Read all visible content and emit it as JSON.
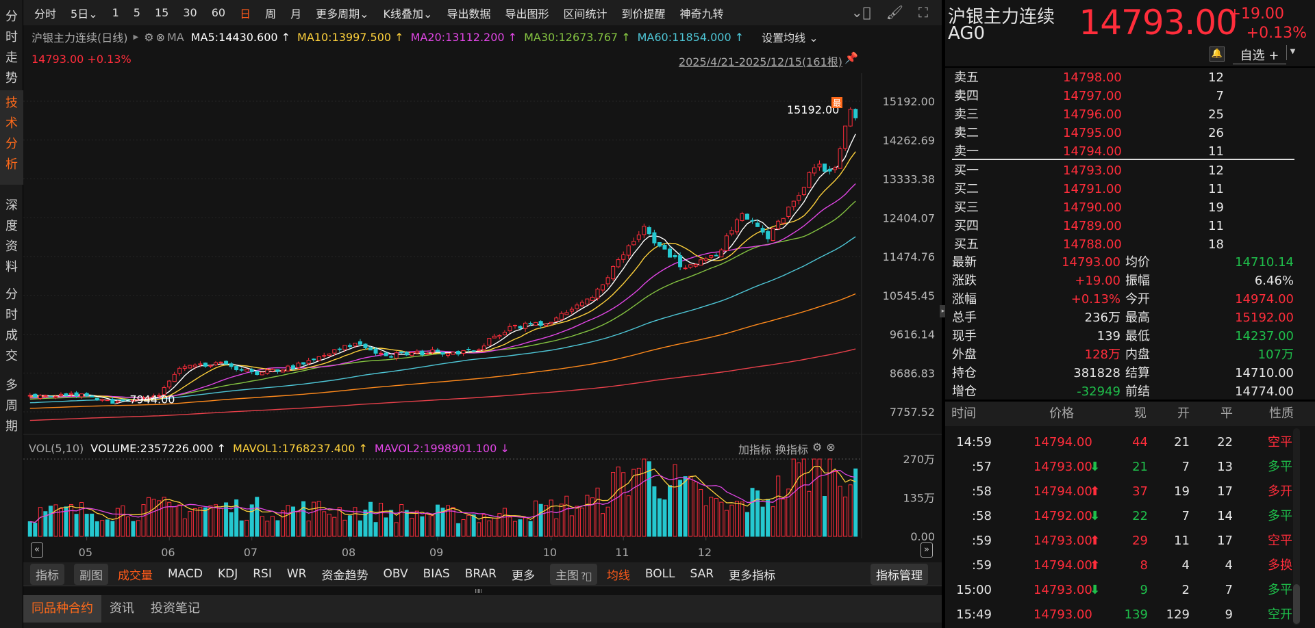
{
  "sidebar": {
    "items": [
      {
        "label": "分时走势"
      },
      {
        "label": "技术分析",
        "active": true
      },
      {
        "label": "深度资料"
      },
      {
        "label": "分时成交"
      },
      {
        "label": "多周期"
      }
    ]
  },
  "toolbar": {
    "items": [
      "分时",
      "5日⌄",
      "1",
      "5",
      "15",
      "30",
      "60",
      "日",
      "周",
      "月",
      "更多周期⌄",
      "K线叠加⌄",
      "导出数据",
      "导出图形",
      "区间统计",
      "到价提醒",
      "神奇九转"
    ],
    "active": "日",
    "icons": [
      "chevron-circle-icon",
      "brush-icon",
      "fullscreen-icon"
    ]
  },
  "chart": {
    "title": "沪银主力连续(日线)",
    "ma_label": "MA",
    "ma": [
      {
        "text": "MA5:14430.600 ↑",
        "color": "#ffffff"
      },
      {
        "text": "MA10:13997.500 ↑",
        "color": "#ffd23c"
      },
      {
        "text": "MA20:13112.200 ↑",
        "color": "#e246e6"
      },
      {
        "text": "MA30:12673.767 ↑",
        "color": "#84c341"
      },
      {
        "text": "MA60:11854.000 ↑",
        "color": "#4ec6d6"
      }
    ],
    "ma_settings": "设置均线 ⌄",
    "price_line": "14793.00  +0.13%",
    "date_range": "2025/4/21-2025/12/15(161根)",
    "high_label": "15192.00",
    "high_badge": "最",
    "low_label": "7944.00",
    "vol_header": {
      "name": "VOL(5,10)",
      "volume": "VOLUME:2357226.000 ↑",
      "mavol1": "MAVOL1:1768237.400 ↑",
      "mavol2": "MAVOL2:1998901.100 ↓",
      "add": "加指标",
      "switch": "换指标"
    },
    "colors": {
      "up": "#ff2d3b",
      "down": "#25c8d0",
      "ma5": "#ffffff",
      "ma10": "#ffd23c",
      "ma20": "#e246e6",
      "ma30": "#84c341",
      "ma60": "#4ec6d6",
      "ma120": "#ff8a1c",
      "ma250": "#e8404a"
    }
  },
  "chart_data": {
    "type": "candlestick",
    "bars": 161,
    "y_ticks": [
      "15192.00",
      "14262.69",
      "13333.38",
      "12404.07",
      "11474.76",
      "10545.45",
      "9616.14",
      "8686.83",
      "7757.52"
    ],
    "ylim": [
      7757.52,
      15192.0
    ],
    "x_ticks": [
      "05",
      "06",
      "07",
      "08",
      "09",
      "10",
      "11",
      "12"
    ],
    "x_tick_bars": [
      11,
      27,
      43,
      62,
      79,
      101,
      115,
      131
    ],
    "close_keypoints": [
      [
        -250,
        6900
      ],
      [
        -150,
        7500
      ],
      [
        -60,
        7800
      ],
      [
        0,
        8150
      ],
      [
        8,
        8200
      ],
      [
        16,
        7960
      ],
      [
        25,
        8150
      ],
      [
        29,
        8800
      ],
      [
        38,
        8900
      ],
      [
        44,
        8650
      ],
      [
        53,
        8900
      ],
      [
        63,
        9400
      ],
      [
        69,
        9100
      ],
      [
        79,
        9200
      ],
      [
        86,
        9200
      ],
      [
        93,
        9800
      ],
      [
        101,
        9900
      ],
      [
        109,
        10500
      ],
      [
        114,
        11400
      ],
      [
        119,
        12200
      ],
      [
        121,
        11800
      ],
      [
        127,
        11200
      ],
      [
        133,
        11500
      ],
      [
        138,
        12500
      ],
      [
        143,
        11900
      ],
      [
        148,
        12800
      ],
      [
        152,
        13600
      ],
      [
        156,
        13600
      ],
      [
        158,
        14600
      ],
      [
        159,
        15000
      ],
      [
        160,
        14793
      ]
    ],
    "volume_ticks": [
      "270万",
      "135万",
      "0.00"
    ],
    "volume_max": 2700000,
    "volume_keypoints": [
      [
        0,
        800000
      ],
      [
        30,
        1000000
      ],
      [
        60,
        900000
      ],
      [
        90,
        700000
      ],
      [
        110,
        1200000
      ],
      [
        118,
        2500000
      ],
      [
        125,
        1800000
      ],
      [
        135,
        900000
      ],
      [
        145,
        1600000
      ],
      [
        152,
        2600000
      ],
      [
        160,
        2357226
      ]
    ]
  },
  "indicator_bar": {
    "btn1": "指标",
    "btn2": "副图",
    "items": [
      "成交量",
      "MACD",
      "KDJ",
      "RSI",
      "WR",
      "资金趋势",
      "OBV",
      "BIAS",
      "BRAR",
      "更多"
    ],
    "active": "成交量",
    "main_btn": "主图",
    "main_items": [
      "均线",
      "BOLL",
      "SAR",
      "更多指标"
    ],
    "main_active": "均线",
    "manage": "指标管理"
  },
  "bottom_tabs": [
    "同品种合约",
    "资讯",
    "投资笔记"
  ],
  "quote": {
    "name": "沪银主力连续",
    "code": "AG0",
    "price": "14793.00",
    "change": "+19.00",
    "pct": "+0.13%",
    "watch": "自选 +"
  },
  "orderbook": {
    "asks": [
      {
        "label": "卖五",
        "price": "14798.00",
        "qty": "12"
      },
      {
        "label": "卖四",
        "price": "14797.00",
        "qty": "7"
      },
      {
        "label": "卖三",
        "price": "14796.00",
        "qty": "25"
      },
      {
        "label": "卖二",
        "price": "14795.00",
        "qty": "26"
      },
      {
        "label": "卖一",
        "price": "14794.00",
        "qty": "11"
      }
    ],
    "bids": [
      {
        "label": "买一",
        "price": "14793.00",
        "qty": "12"
      },
      {
        "label": "买二",
        "price": "14791.00",
        "qty": "11"
      },
      {
        "label": "买三",
        "price": "14790.00",
        "qty": "19"
      },
      {
        "label": "买四",
        "price": "14789.00",
        "qty": "11"
      },
      {
        "label": "买五",
        "price": "14788.00",
        "qty": "18"
      }
    ]
  },
  "stats": [
    {
      "l1": "最新",
      "v1": "14793.00",
      "c1": "red",
      "l2": "均价",
      "v2": "14710.14",
      "c2": "green"
    },
    {
      "l1": "涨跌",
      "v1": "+19.00",
      "c1": "red",
      "l2": "振幅",
      "v2": "6.46%",
      "c2": "white"
    },
    {
      "l1": "涨幅",
      "v1": "+0.13%",
      "c1": "red",
      "l2": "今开",
      "v2": "14974.00",
      "c2": "red"
    },
    {
      "l1": "总手",
      "v1": "236万",
      "c1": "white",
      "l2": "最高",
      "v2": "15192.00",
      "c2": "red"
    },
    {
      "l1": "现手",
      "v1": "139",
      "c1": "white",
      "l2": "最低",
      "v2": "14237.00",
      "c2": "green"
    },
    {
      "l1": "外盘",
      "v1": "128万",
      "c1": "red",
      "l2": "内盘",
      "v2": "107万",
      "c2": "green"
    },
    {
      "l1": "持仓",
      "v1": "381828",
      "c1": "white",
      "l2": "结算",
      "v2": "14710.00",
      "c2": "white"
    },
    {
      "l1": "增仓",
      "v1": "-32949",
      "c1": "green",
      "l2": "前结",
      "v2": "14774.00",
      "c2": "white"
    }
  ],
  "trades": {
    "headers": [
      "时间",
      "价格",
      "现",
      "开",
      "平",
      "性质"
    ],
    "rows": [
      {
        "time": "14:59",
        "price": "14794.00",
        "arrow": "",
        "now": "44",
        "nc": "red",
        "open": "21",
        "close": "22",
        "kind": "空平",
        "kc": "red"
      },
      {
        "time": ":57",
        "price": "14793.00",
        "arrow": "down",
        "now": "21",
        "nc": "green",
        "open": "7",
        "close": "13",
        "kind": "多平",
        "kc": "green"
      },
      {
        "time": ":58",
        "price": "14794.00",
        "arrow": "up",
        "now": "37",
        "nc": "red",
        "open": "19",
        "close": "17",
        "kind": "多开",
        "kc": "red"
      },
      {
        "time": ":58",
        "price": "14792.00",
        "arrow": "down",
        "now": "22",
        "nc": "green",
        "open": "7",
        "close": "14",
        "kind": "多平",
        "kc": "green"
      },
      {
        "time": ":59",
        "price": "14793.00",
        "arrow": "up",
        "now": "29",
        "nc": "red",
        "open": "11",
        "close": "17",
        "kind": "空平",
        "kc": "red"
      },
      {
        "time": ":59",
        "price": "14794.00",
        "arrow": "up",
        "now": "8",
        "nc": "red",
        "open": "4",
        "close": "4",
        "kind": "多换",
        "kc": "red"
      },
      {
        "time": "15:00",
        "price": "14793.00",
        "arrow": "down",
        "now": "9",
        "nc": "green",
        "open": "2",
        "close": "7",
        "kind": "多平",
        "kc": "green"
      },
      {
        "time": "15:49",
        "price": "14793.00",
        "arrow": "",
        "now": "139",
        "nc": "green",
        "open": "129",
        "close": "9",
        "kind": "空开",
        "kc": "green"
      }
    ]
  }
}
